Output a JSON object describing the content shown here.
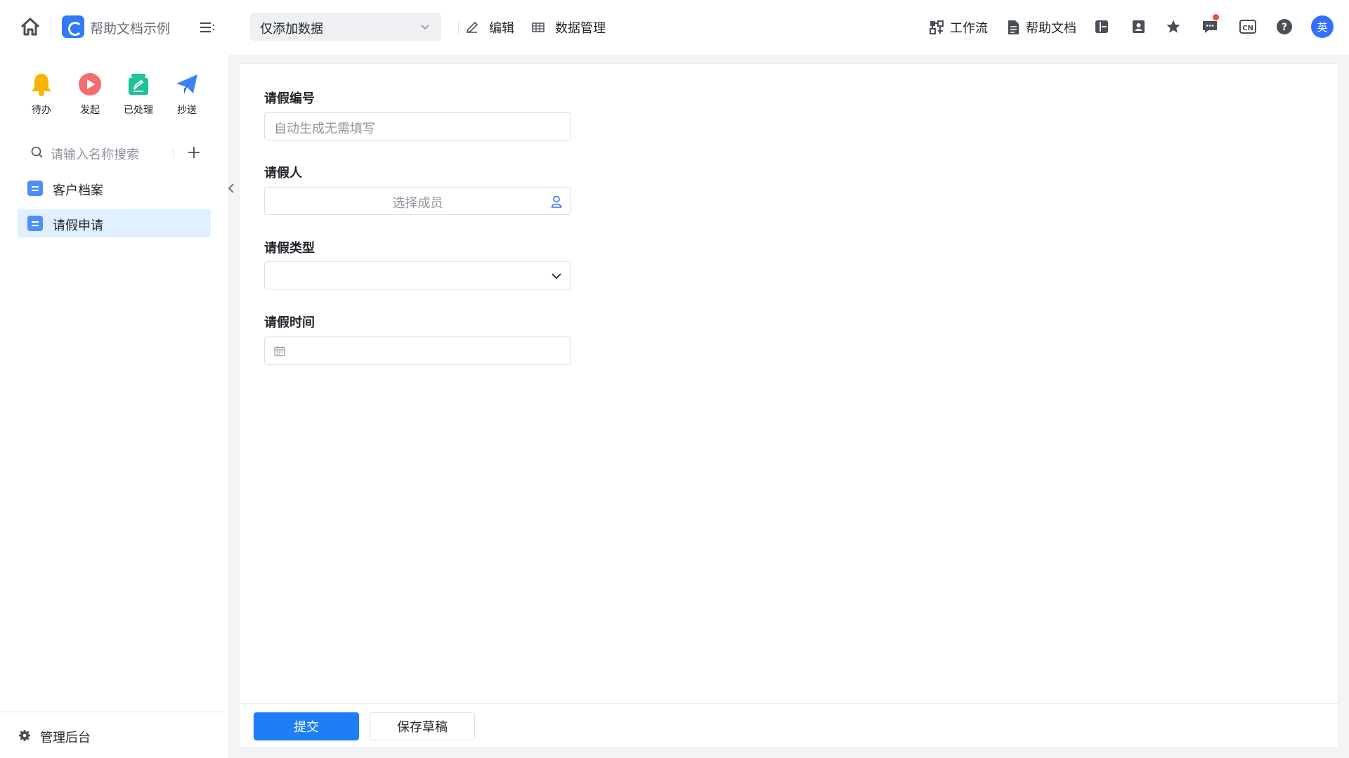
{
  "header": {
    "app_name": "帮助文档示例",
    "view_selector": "仅添加数据",
    "edit_label": "编辑",
    "data_manage_label": "数据管理",
    "workflow_label": "工作流",
    "help_docs_label": "帮助文档",
    "language_label": "CN",
    "avatar_text": "英"
  },
  "sidebar": {
    "quick_actions": [
      {
        "label": "待办",
        "icon": "bell-icon"
      },
      {
        "label": "发起",
        "icon": "play-icon"
      },
      {
        "label": "已处理",
        "icon": "processed-icon"
      },
      {
        "label": "抄送",
        "icon": "send-icon"
      }
    ],
    "search_placeholder": "请输入名称搜索",
    "items": [
      {
        "label": "客户档案",
        "active": false
      },
      {
        "label": "请假申请",
        "active": true
      }
    ],
    "admin_label": "管理后台"
  },
  "form": {
    "fields": [
      {
        "label": "请假编号",
        "placeholder": "自动生成无需填写",
        "type": "text"
      },
      {
        "label": "请假人",
        "placeholder": "选择成员",
        "type": "member"
      },
      {
        "label": "请假类型",
        "placeholder": "",
        "type": "select"
      },
      {
        "label": "请假时间",
        "placeholder": "",
        "type": "date"
      }
    ],
    "submit_label": "提交",
    "draft_label": "保存草稿"
  },
  "colors": {
    "primary": "#1f7ef5",
    "active_bg": "#e1f0ff",
    "bell": "#f7b500",
    "play": "#f56c6c",
    "processed": "#1fc39a",
    "send": "#3c84f7"
  }
}
